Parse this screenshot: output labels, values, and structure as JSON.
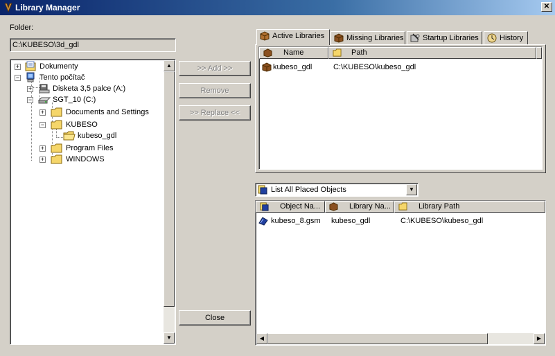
{
  "window": {
    "title": "Library Manager",
    "close_glyph": "✕"
  },
  "folder": {
    "label": "Folder:",
    "path": "C:\\KUBESO\\3d_gdl"
  },
  "tree": {
    "items": [
      {
        "label": "Dokumenty",
        "icon": "documents-icon",
        "expander": "+"
      },
      {
        "label": "Tento počítač",
        "icon": "computer-icon",
        "expander": "−"
      },
      {
        "label": "Disketa 3,5 palce (A:)",
        "icon": "floppy-drive-icon",
        "expander": "+"
      },
      {
        "label": "SGT_10 (C:)",
        "icon": "hard-drive-icon",
        "expander": "−"
      },
      {
        "label": "Documents and Settings",
        "icon": "folder-icon",
        "expander": "+"
      },
      {
        "label": "KUBESO",
        "icon": "folder-icon",
        "expander": "−"
      },
      {
        "label": "kubeso_gdl",
        "icon": "folder-open-icon",
        "expander": ""
      },
      {
        "label": "Program Files",
        "icon": "folder-icon",
        "expander": "+"
      },
      {
        "label": "WINDOWS",
        "icon": "folder-icon",
        "expander": "+"
      }
    ]
  },
  "buttons": {
    "add": ">> Add >>",
    "remove": "Remove",
    "replace": ">> Replace <<",
    "close": "Close"
  },
  "tabs": [
    {
      "label": "Active Libraries",
      "icon": "library-box-icon"
    },
    {
      "label": "Missing Libraries",
      "icon": "library-box-icon"
    },
    {
      "label": "Startup Libraries",
      "icon": "startup-icon"
    },
    {
      "label": "History",
      "icon": "history-icon"
    }
  ],
  "active_libraries": {
    "columns": [
      "Name",
      "Path"
    ],
    "rows": [
      {
        "name": "kubeso_gdl",
        "path": "C:\\KUBESO\\kubeso_gdl"
      }
    ]
  },
  "placed_objects": {
    "dropdown": "List All Placed Objects",
    "columns": [
      "Object Na...",
      "Library Na...",
      "Library Path"
    ],
    "rows": [
      {
        "object": "kubeso_8.gsm",
        "library": "kubeso_gdl",
        "path": "C:\\KUBESO\\kubeso_gdl"
      }
    ]
  },
  "scroll_glyphs": {
    "up": "▲",
    "down": "▼",
    "left": "◀",
    "right": "▶"
  },
  "colors": {
    "title_start": "#0a246a",
    "title_end": "#a6caf0",
    "face": "#d4d0c8",
    "folder": "#f5d66a"
  }
}
